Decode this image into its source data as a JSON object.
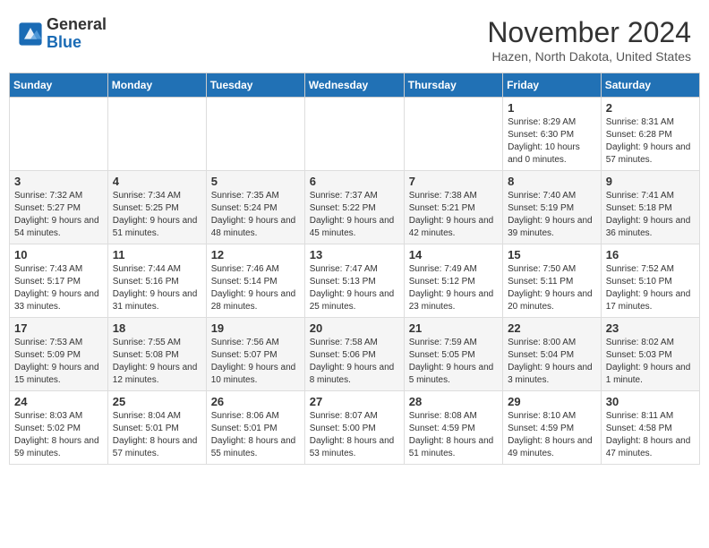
{
  "header": {
    "logo_line1": "General",
    "logo_line2": "Blue",
    "month": "November 2024",
    "location": "Hazen, North Dakota, United States"
  },
  "days_of_week": [
    "Sunday",
    "Monday",
    "Tuesday",
    "Wednesday",
    "Thursday",
    "Friday",
    "Saturday"
  ],
  "weeks": [
    [
      {
        "day": "",
        "info": ""
      },
      {
        "day": "",
        "info": ""
      },
      {
        "day": "",
        "info": ""
      },
      {
        "day": "",
        "info": ""
      },
      {
        "day": "",
        "info": ""
      },
      {
        "day": "1",
        "info": "Sunrise: 8:29 AM\nSunset: 6:30 PM\nDaylight: 10 hours and 0 minutes."
      },
      {
        "day": "2",
        "info": "Sunrise: 8:31 AM\nSunset: 6:28 PM\nDaylight: 9 hours and 57 minutes."
      }
    ],
    [
      {
        "day": "3",
        "info": "Sunrise: 7:32 AM\nSunset: 5:27 PM\nDaylight: 9 hours and 54 minutes."
      },
      {
        "day": "4",
        "info": "Sunrise: 7:34 AM\nSunset: 5:25 PM\nDaylight: 9 hours and 51 minutes."
      },
      {
        "day": "5",
        "info": "Sunrise: 7:35 AM\nSunset: 5:24 PM\nDaylight: 9 hours and 48 minutes."
      },
      {
        "day": "6",
        "info": "Sunrise: 7:37 AM\nSunset: 5:22 PM\nDaylight: 9 hours and 45 minutes."
      },
      {
        "day": "7",
        "info": "Sunrise: 7:38 AM\nSunset: 5:21 PM\nDaylight: 9 hours and 42 minutes."
      },
      {
        "day": "8",
        "info": "Sunrise: 7:40 AM\nSunset: 5:19 PM\nDaylight: 9 hours and 39 minutes."
      },
      {
        "day": "9",
        "info": "Sunrise: 7:41 AM\nSunset: 5:18 PM\nDaylight: 9 hours and 36 minutes."
      }
    ],
    [
      {
        "day": "10",
        "info": "Sunrise: 7:43 AM\nSunset: 5:17 PM\nDaylight: 9 hours and 33 minutes."
      },
      {
        "day": "11",
        "info": "Sunrise: 7:44 AM\nSunset: 5:16 PM\nDaylight: 9 hours and 31 minutes."
      },
      {
        "day": "12",
        "info": "Sunrise: 7:46 AM\nSunset: 5:14 PM\nDaylight: 9 hours and 28 minutes."
      },
      {
        "day": "13",
        "info": "Sunrise: 7:47 AM\nSunset: 5:13 PM\nDaylight: 9 hours and 25 minutes."
      },
      {
        "day": "14",
        "info": "Sunrise: 7:49 AM\nSunset: 5:12 PM\nDaylight: 9 hours and 23 minutes."
      },
      {
        "day": "15",
        "info": "Sunrise: 7:50 AM\nSunset: 5:11 PM\nDaylight: 9 hours and 20 minutes."
      },
      {
        "day": "16",
        "info": "Sunrise: 7:52 AM\nSunset: 5:10 PM\nDaylight: 9 hours and 17 minutes."
      }
    ],
    [
      {
        "day": "17",
        "info": "Sunrise: 7:53 AM\nSunset: 5:09 PM\nDaylight: 9 hours and 15 minutes."
      },
      {
        "day": "18",
        "info": "Sunrise: 7:55 AM\nSunset: 5:08 PM\nDaylight: 9 hours and 12 minutes."
      },
      {
        "day": "19",
        "info": "Sunrise: 7:56 AM\nSunset: 5:07 PM\nDaylight: 9 hours and 10 minutes."
      },
      {
        "day": "20",
        "info": "Sunrise: 7:58 AM\nSunset: 5:06 PM\nDaylight: 9 hours and 8 minutes."
      },
      {
        "day": "21",
        "info": "Sunrise: 7:59 AM\nSunset: 5:05 PM\nDaylight: 9 hours and 5 minutes."
      },
      {
        "day": "22",
        "info": "Sunrise: 8:00 AM\nSunset: 5:04 PM\nDaylight: 9 hours and 3 minutes."
      },
      {
        "day": "23",
        "info": "Sunrise: 8:02 AM\nSunset: 5:03 PM\nDaylight: 9 hours and 1 minute."
      }
    ],
    [
      {
        "day": "24",
        "info": "Sunrise: 8:03 AM\nSunset: 5:02 PM\nDaylight: 8 hours and 59 minutes."
      },
      {
        "day": "25",
        "info": "Sunrise: 8:04 AM\nSunset: 5:01 PM\nDaylight: 8 hours and 57 minutes."
      },
      {
        "day": "26",
        "info": "Sunrise: 8:06 AM\nSunset: 5:01 PM\nDaylight: 8 hours and 55 minutes."
      },
      {
        "day": "27",
        "info": "Sunrise: 8:07 AM\nSunset: 5:00 PM\nDaylight: 8 hours and 53 minutes."
      },
      {
        "day": "28",
        "info": "Sunrise: 8:08 AM\nSunset: 4:59 PM\nDaylight: 8 hours and 51 minutes."
      },
      {
        "day": "29",
        "info": "Sunrise: 8:10 AM\nSunset: 4:59 PM\nDaylight: 8 hours and 49 minutes."
      },
      {
        "day": "30",
        "info": "Sunrise: 8:11 AM\nSunset: 4:58 PM\nDaylight: 8 hours and 47 minutes."
      }
    ]
  ]
}
